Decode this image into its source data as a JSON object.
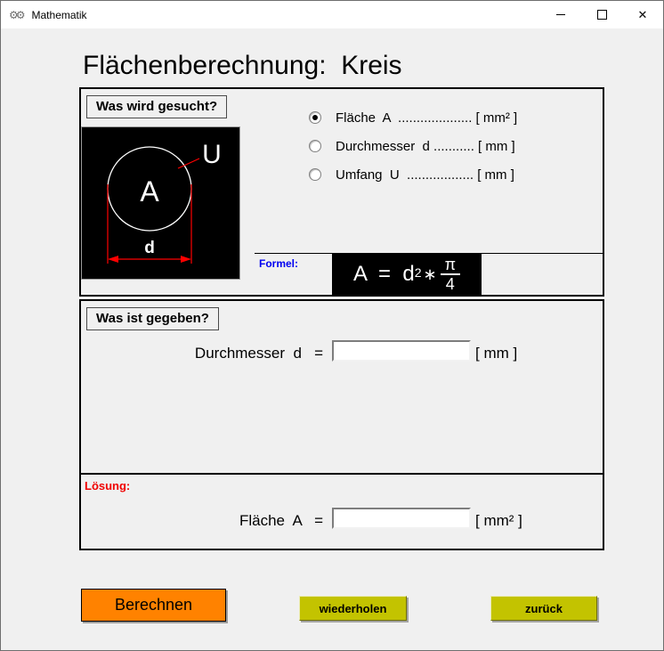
{
  "window": {
    "title": "Mathematik",
    "controls": {
      "close_glyph": "✕"
    }
  },
  "page": {
    "heading": "Flächenberechnung:  Kreis"
  },
  "sought": {
    "header": "Was wird gesucht?",
    "options": [
      {
        "text": "Fläche  A  .................... [ mm² ]",
        "selected": true
      },
      {
        "text": "Durchmesser  d ........... [ mm ]",
        "selected": false
      },
      {
        "text": "Umfang  U  .................. [ mm ]",
        "selected": false
      }
    ]
  },
  "diagram": {
    "area_label": "A",
    "circumference_label": "U",
    "diameter_label": "d"
  },
  "formula": {
    "label": "Formel:",
    "lhs": "A  =  d",
    "exponent": "2",
    "operator": "∗",
    "numerator": "π",
    "denominator": "4"
  },
  "given": {
    "header": "Was ist gegeben?",
    "field_label": "Durchmesser  d   =",
    "value": "",
    "unit": "[ mm ]"
  },
  "solution": {
    "header": "Lösung:",
    "field_label": "Fläche  A   =",
    "value": "",
    "unit": "[ mm² ]"
  },
  "buttons": {
    "calculate": "Berechnen",
    "repeat": "wiederholen",
    "back": "zurück"
  },
  "colors": {
    "calculate_orange": "#ff8200",
    "secondary_olive": "#c3c300",
    "formula_bg": "#000000",
    "formel_blue": "#0000f0",
    "loesung_red": "#f00000",
    "dimension_red": "#ff0000",
    "window_bg": "#f0f0f0",
    "titlebar_bg": "#ffffff"
  }
}
